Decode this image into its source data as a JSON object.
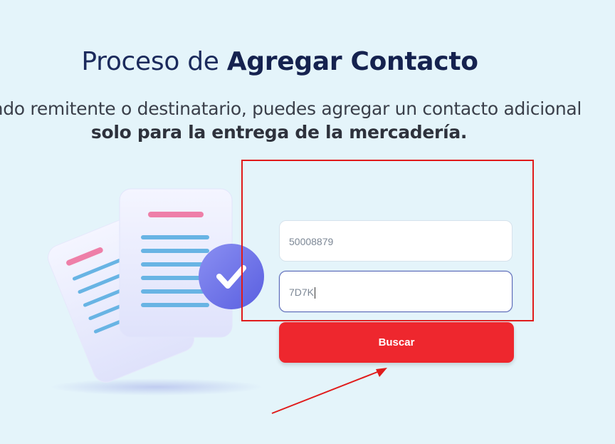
{
  "header": {
    "title_prefix": "Proceso de ",
    "title_bold": "Agregar Contacto",
    "subtitle_line1": "iendo remitente o destinatario, puedes agregar un contacto adicional",
    "subtitle_line2": "solo para la entrega de la mercadería."
  },
  "form": {
    "field1_value": "50008879",
    "field2_value": "7D7K",
    "search_label": "Buscar"
  },
  "colors": {
    "background": "#e4f4fa",
    "title": "#1b2a5c",
    "button": "#ee272e",
    "annotation": "#e01b1b",
    "focus_border": "#5868b8"
  },
  "icons": [
    "document-illustration",
    "check-badge-icon",
    "annotation-arrow"
  ]
}
